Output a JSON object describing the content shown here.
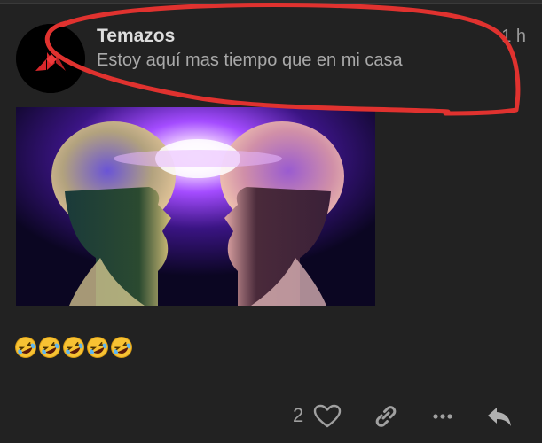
{
  "post": {
    "username": "Temazos",
    "message": "Estoy aquí mas tiempo que en mi casa",
    "timestamp": "1 h",
    "avatar_icon": "brand-logo-icon",
    "image_description_icon": "two-heads-glowing-brains-image",
    "reaction_emojis": [
      "rolling-on-floor-laughing",
      "rolling-on-floor-laughing",
      "rolling-on-floor-laughing",
      "rolling-on-floor-laughing",
      "rolling-on-floor-laughing"
    ]
  },
  "actions": {
    "like_count": "2",
    "icons": [
      "heart-icon",
      "link-icon",
      "more-icon",
      "reply-icon"
    ]
  },
  "colors": {
    "background": "#222222",
    "annotation_stroke": "#e0322f",
    "username": "#dddddd",
    "muted_text": "#a9a9a9"
  }
}
